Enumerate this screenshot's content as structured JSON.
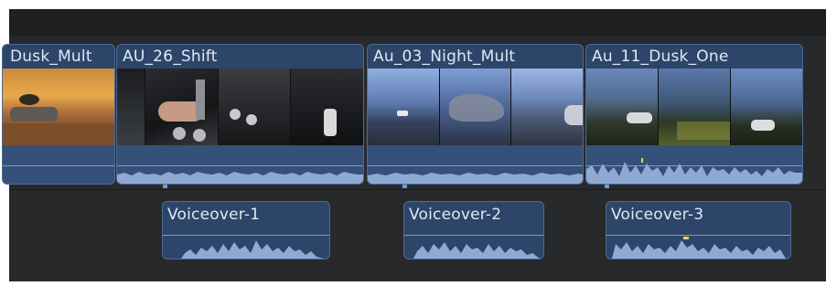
{
  "colors": {
    "timeline_bg": "#28292b",
    "clip_bg": "#2d4568",
    "clip_border": "#4e6a92",
    "waveform": "#8eaad3",
    "marker": "#6a9ee0"
  },
  "video_clips": [
    {
      "title": "Dusk_Mult"
    },
    {
      "title": "AU_26_Shift"
    },
    {
      "title": "Au_03_Night_Mult"
    },
    {
      "title": "Au_11_Dusk_One"
    }
  ],
  "voiceover_clips": [
    {
      "title": "Voiceover-1"
    },
    {
      "title": "Voiceover-2"
    },
    {
      "title": "Voiceover-3"
    }
  ]
}
